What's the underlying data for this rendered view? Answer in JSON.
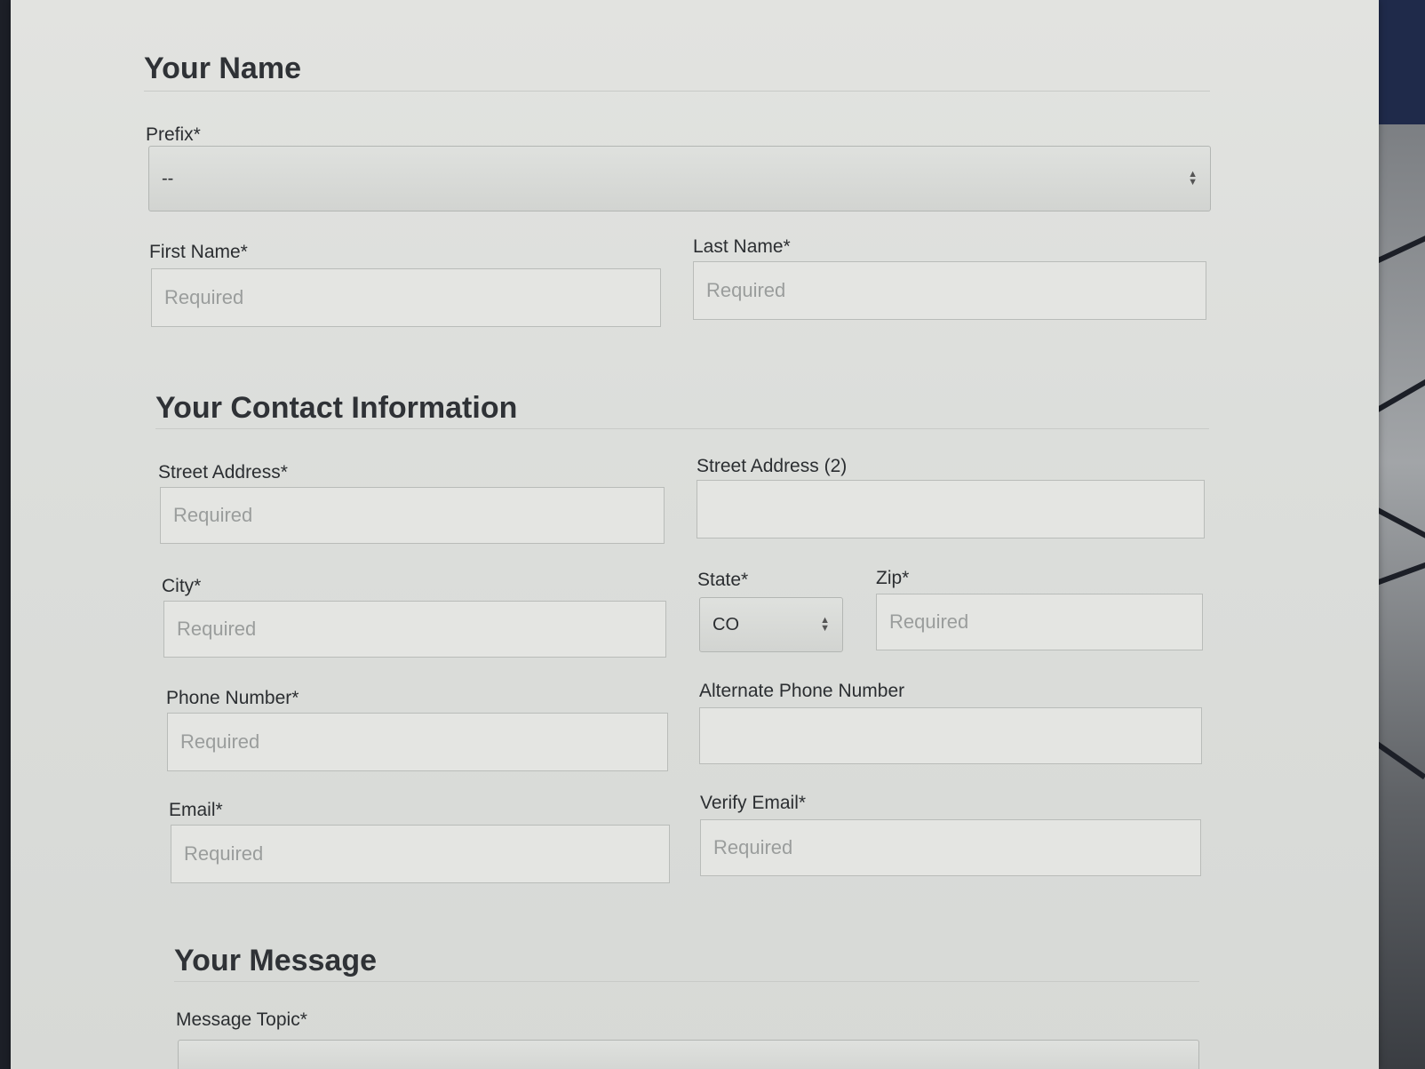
{
  "sections": {
    "name": {
      "title": "Your Name",
      "prefix_label": "Prefix*",
      "prefix_value": "--",
      "first_name_label": "First Name*",
      "first_name_placeholder": "Required",
      "last_name_label": "Last Name*",
      "last_name_placeholder": "Required"
    },
    "contact": {
      "title": "Your Contact Information",
      "street_label": "Street Address*",
      "street_placeholder": "Required",
      "street2_label": "Street Address (2)",
      "street2_placeholder": "",
      "city_label": "City*",
      "city_placeholder": "Required",
      "state_label": "State*",
      "state_value": "CO",
      "zip_label": "Zip*",
      "zip_placeholder": "Required",
      "phone_label": "Phone Number*",
      "phone_placeholder": "Required",
      "alt_phone_label": "Alternate Phone Number",
      "alt_phone_placeholder": "",
      "email_label": "Email*",
      "email_placeholder": "Required",
      "verify_email_label": "Verify Email*",
      "verify_email_placeholder": "Required"
    },
    "message": {
      "title": "Your Message",
      "topic_label": "Message Topic*"
    }
  },
  "icons": {
    "select_arrows": "up-down-arrows-icon"
  },
  "colors": {
    "page_background": "#dcdedb",
    "field_border": "#b9bcb9",
    "placeholder_text": "#9a9d9c",
    "heading_text": "#2f3236"
  }
}
